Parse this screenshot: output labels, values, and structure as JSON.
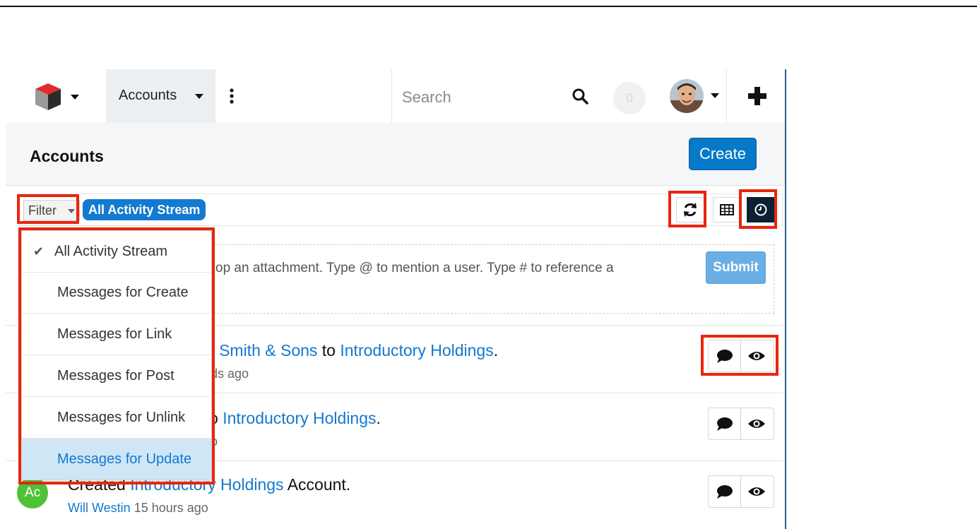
{
  "nav": {
    "module_label": "Accounts",
    "search_placeholder": "Search",
    "notification_count": "0"
  },
  "header": {
    "title": "Accounts",
    "create_label": "Create"
  },
  "filter": {
    "button_label": "Filter",
    "active_filter": "All Activity Stream"
  },
  "composer": {
    "text": "op an attachment. Type @ to mention a user. Type # to reference a",
    "submit_label": "Submit"
  },
  "dropdown": {
    "items": [
      {
        "label": "All Activity Stream",
        "checked": true
      },
      {
        "label": "Messages for Create"
      },
      {
        "label": "Messages for Link"
      },
      {
        "label": "Messages for Post"
      },
      {
        "label": "Messages for Unlink"
      },
      {
        "label": "Messages for Update",
        "selected": true
      }
    ]
  },
  "activities": [
    {
      "prefix": "r",
      "link1": "Smith & Sons",
      "middle": "to",
      "link2": "Introductory Holdings",
      "suffix": ".",
      "meta": "ds ago"
    },
    {
      "prefix": "o",
      "link1": "Introductory Holdings",
      "suffix": ".",
      "meta": "o"
    },
    {
      "prefix": "Created",
      "link1": "Introductory Holdings",
      "suffix": "Account.",
      "author": "Will Westin",
      "meta": "15 hours ago",
      "avatar_initials": "Ac"
    }
  ],
  "colors": {
    "accent": "#0679c8",
    "link": "#1478cc",
    "highlight": "#e8260f",
    "pill": "#1479d0",
    "active_view": "#0b2033",
    "selected_item_bg": "#cfe6f7",
    "avatar_green": "#4dc238"
  }
}
